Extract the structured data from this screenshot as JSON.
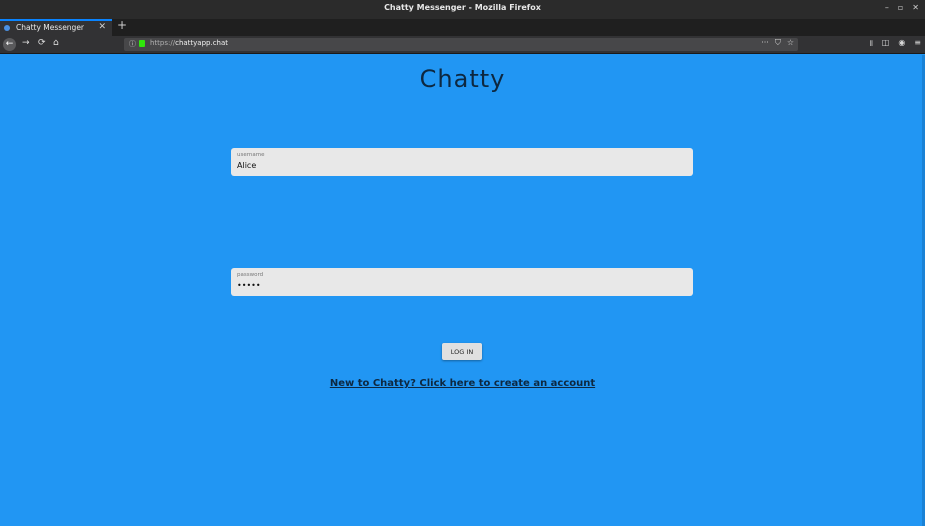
{
  "window": {
    "title": "Chatty Messenger - Mozilla Firefox",
    "controls": [
      "–",
      "▫",
      "✕"
    ]
  },
  "tab": {
    "label": "Chatty Messenger",
    "close": "✕",
    "new_tab": "+"
  },
  "nav": {
    "back": "←",
    "forward": "→",
    "reload": "⟳",
    "home": "⌂",
    "info": "ⓘ",
    "url_scheme": "https://",
    "url_host": "chattyapp.chat",
    "url_more": "···",
    "url_pocket": "⛉",
    "url_bookmark": "☆",
    "library": "𝍪",
    "sidebar": "◫",
    "account": "◉",
    "menu": "≡"
  },
  "page": {
    "title": "Chatty",
    "username_label": "username",
    "username_value": "Alice",
    "password_label": "password",
    "password_value": "•••••",
    "login_label": "LOG IN",
    "signup_link": "New to Chatty? Click here to create an account"
  },
  "colors": {
    "background": "#2196f3",
    "title_text": "#0d2840",
    "field_bg": "#e8e8e8"
  }
}
